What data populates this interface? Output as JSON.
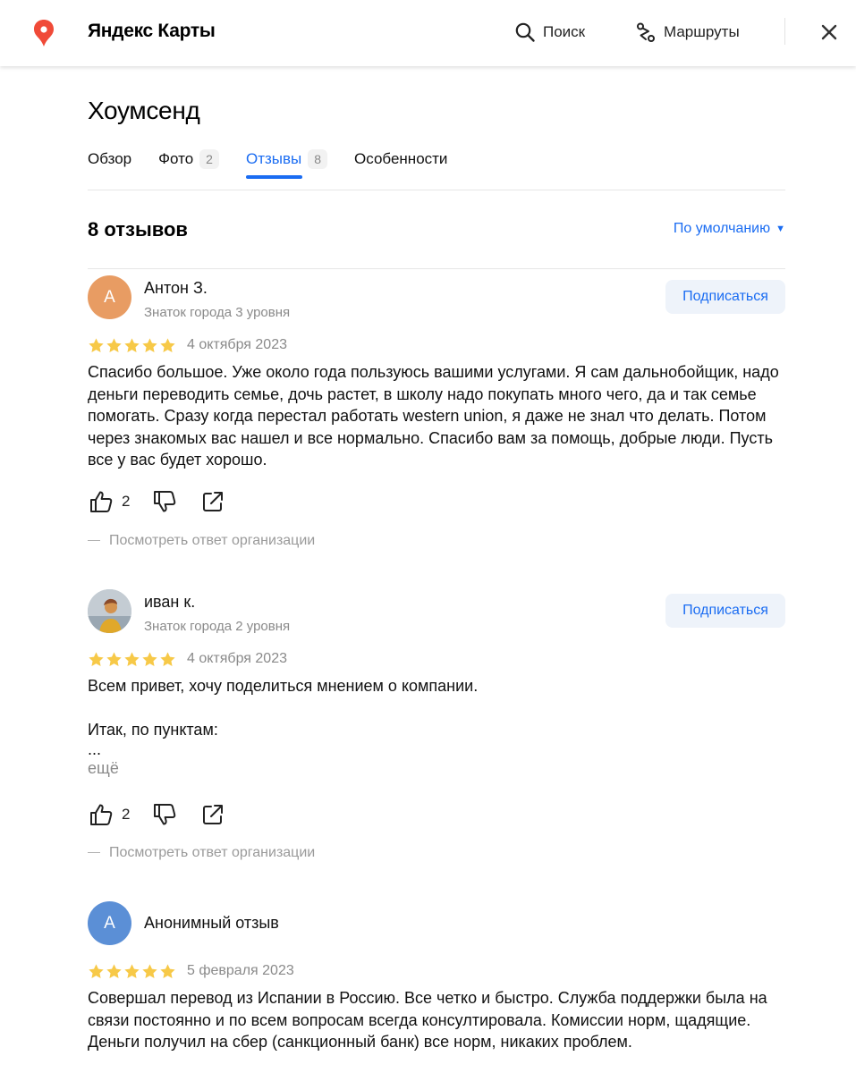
{
  "header": {
    "brand": "Яндекс Карты",
    "search_label": "Поиск",
    "routes_label": "Маршруты"
  },
  "place": {
    "title": "Хоумсенд"
  },
  "tabs": [
    {
      "label": "Обзор",
      "count": ""
    },
    {
      "label": "Фото",
      "count": "2"
    },
    {
      "label": "Отзывы",
      "count": "8",
      "active": true
    },
    {
      "label": "Особенности",
      "count": ""
    }
  ],
  "reviews_header": {
    "count_label": "8 отзывов",
    "sort_label": "По умолчанию"
  },
  "reviews": [
    {
      "avatar_letter": "А",
      "author": "Антон З.",
      "level": "Знаток города 3 уровня",
      "subscribe_label": "Подписаться",
      "rating": 5,
      "date": "4 октября 2023",
      "text": [
        "Спасибо большое. Уже около года пользуюсь вашими услугами. Я сам дальнобойщик, надо деньги переводить семье, дочь растет, в школу надо покупать много чего, да и так семье помогать. Сразу когда перестал работать western union, я даже не знал что делать. Потом через знакомых вас нашел и все нормально. Спасибо вам за помощь, добрые люди. Пусть все у вас будет хорошо."
      ],
      "likes": "2",
      "org_reply_label": "Посмотреть ответ организации"
    },
    {
      "avatar_letter": "",
      "author": "иван к.",
      "level": "Знаток города 2 уровня",
      "subscribe_label": "Подписаться",
      "rating": 5,
      "date": "4 октября 2023",
      "text": [
        "Всем привет, хочу поделиться мнением о компании.",
        "",
        "Итак, по пунктам:",
        "..."
      ],
      "more_label": "ещё",
      "likes": "2",
      "org_reply_label": "Посмотреть ответ организации"
    },
    {
      "avatar_letter": "А",
      "author": "Анонимный отзыв",
      "rating": 5,
      "date": "5 февраля 2023",
      "text": [
        "Совершал перевод из Испании в Россию. Все четко и быстро. Служба поддержки была на связи постоянно и по всем вопросам всегда консултировала. Комиссии норм, щадящие. Деньги получил на сбер (санкционный банк) все норм, никаких проблем."
      ]
    }
  ],
  "colors": {
    "accent": "#1a6cf2",
    "star": "#f7c948",
    "avatar_orange": "#e89c63",
    "avatar_blue": "#5b8fd6",
    "pin": "#f04a38"
  }
}
